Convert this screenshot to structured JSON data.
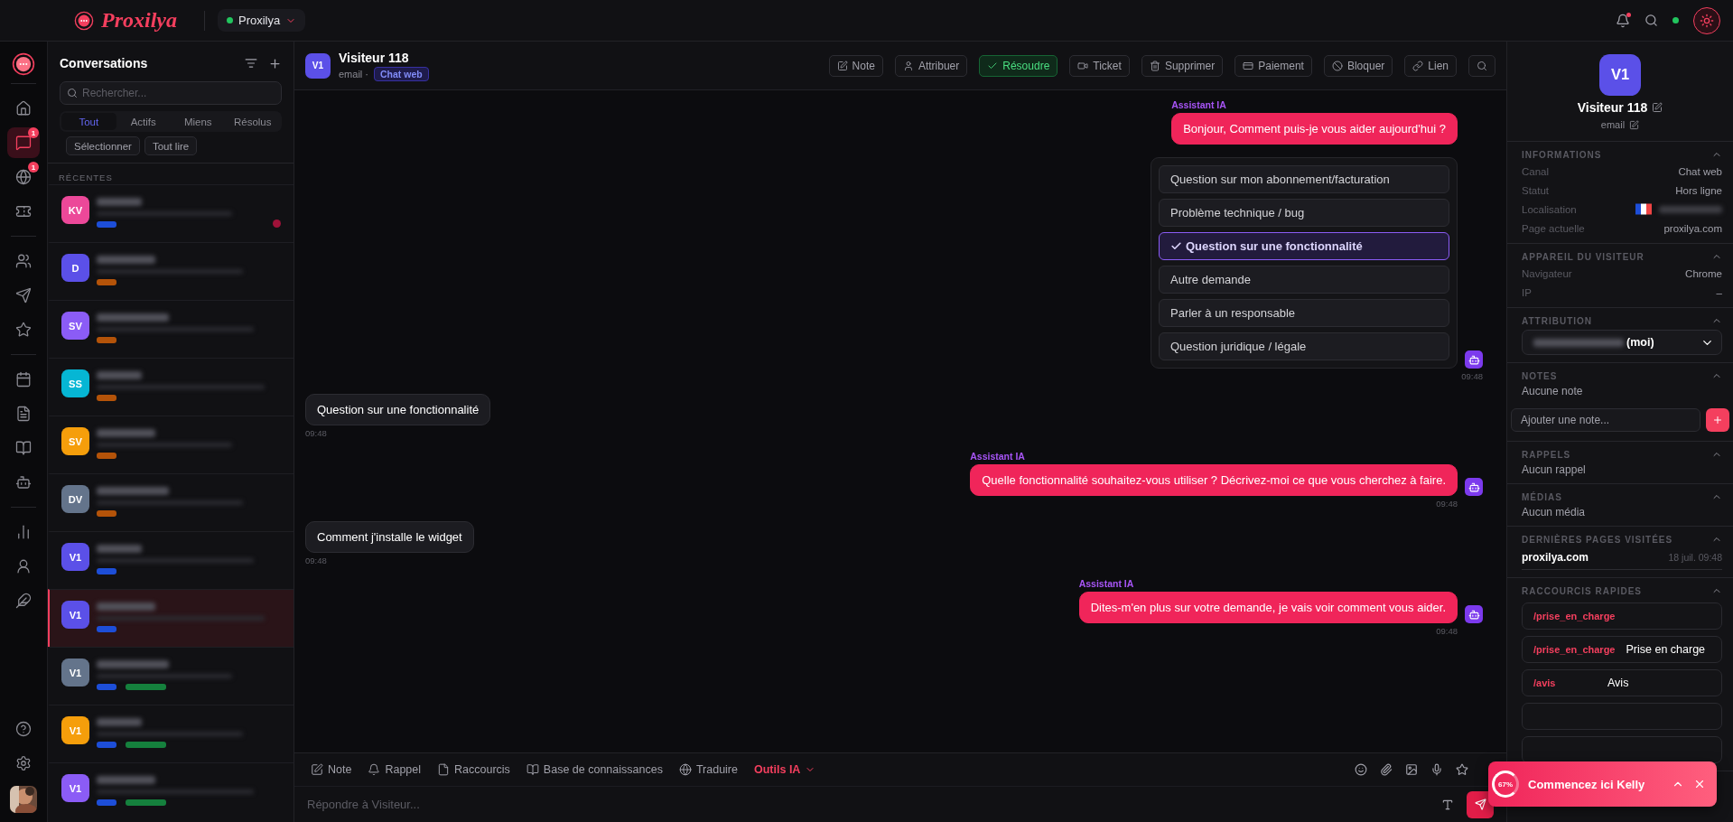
{
  "topbar": {
    "brand": "Proxilya",
    "workspace": "Proxilya",
    "workspace_online": true,
    "notification": true,
    "online": true
  },
  "rail": {
    "groups": [
      [
        {
          "selected": false
        },
        {
          "selected": true,
          "badge": "1"
        },
        {
          "selected": false,
          "badge": "1"
        },
        {
          "selected": false
        }
      ],
      [
        {
          "selected": false
        },
        {
          "selected": false
        },
        {
          "selected": false
        }
      ],
      [
        {
          "selected": false
        },
        {
          "selected": false
        },
        {
          "selected": false
        },
        {
          "selected": false
        }
      ],
      [
        {
          "selected": false
        },
        {
          "selected": false
        },
        {
          "selected": false
        }
      ]
    ],
    "bottom": [
      {
        "selected": false
      },
      {
        "selected": false
      }
    ]
  },
  "conversations": {
    "title": "Conversations",
    "search_placeholder": "Rechercher...",
    "tabs": [
      {
        "label": "Tout",
        "selected": true
      },
      {
        "label": "Actifs",
        "selected": false
      },
      {
        "label": "Miens",
        "selected": false
      },
      {
        "label": "Résolus",
        "selected": false
      }
    ],
    "actions": [
      "Sélectionner",
      "Tout lire"
    ],
    "section": "RÉCENTES",
    "items": [
      {
        "initials": "KV",
        "color": "#ec4899",
        "selected": false,
        "unread": true,
        "tags": [
          {
            "color": "#1d4ed8"
          }
        ]
      },
      {
        "initials": "D",
        "color": "#5b50e8",
        "selected": false,
        "unread": false,
        "tags": [
          {
            "color": "#b45309"
          }
        ]
      },
      {
        "initials": "SV",
        "color": "#8b5cf6",
        "selected": false,
        "unread": false,
        "tags": [
          {
            "color": "#b45309"
          }
        ]
      },
      {
        "initials": "SS",
        "color": "#06b6d4",
        "selected": false,
        "unread": false,
        "tags": [
          {
            "color": "#b45309"
          }
        ]
      },
      {
        "initials": "SV",
        "color": "#f59e0b",
        "selected": false,
        "unread": false,
        "tags": [
          {
            "color": "#b45309"
          }
        ]
      },
      {
        "initials": "DV",
        "color": "#64748b",
        "selected": false,
        "unread": false,
        "tags": [
          {
            "color": "#b45309"
          }
        ]
      },
      {
        "initials": "V1",
        "color": "#5b50e8",
        "selected": false,
        "unread": false,
        "tags": [
          {
            "color": "#1d4ed8"
          }
        ]
      },
      {
        "initials": "V1",
        "color": "#5b50e8",
        "selected": true,
        "unread": false,
        "tags": [
          {
            "color": "#1d4ed8"
          }
        ]
      },
      {
        "initials": "V1",
        "color": "#64748b",
        "selected": false,
        "unread": false,
        "tags": [
          {
            "color": "#1d4ed8"
          },
          {
            "color": "#15803d"
          }
        ]
      },
      {
        "initials": "V1",
        "color": "#f59e0b",
        "selected": false,
        "unread": false,
        "tags": [
          {
            "color": "#1d4ed8"
          },
          {
            "color": "#15803d"
          }
        ]
      },
      {
        "initials": "V1",
        "color": "#8b5cf6",
        "selected": false,
        "unread": false,
        "tags": [
          {
            "color": "#1d4ed8"
          },
          {
            "color": "#15803d"
          }
        ]
      }
    ]
  },
  "chat": {
    "avatar": "V1",
    "title": "Visiteur 118",
    "subtitle": "email ·",
    "channel": "Chat web",
    "actions": [
      {
        "label": "Note",
        "kind": "plain"
      },
      {
        "label": "Attribuer",
        "kind": "plain"
      },
      {
        "label": "Résoudre",
        "kind": "success"
      },
      {
        "label": "Ticket",
        "kind": "plain"
      },
      {
        "label": "Supprimer",
        "kind": "plain"
      },
      {
        "label": "Paiement",
        "kind": "plain"
      },
      {
        "label": "Bloquer",
        "kind": "plain"
      },
      {
        "label": "Lien",
        "kind": "plain"
      },
      {
        "kind": "icon"
      }
    ],
    "messages": [
      {
        "kind": "bot",
        "sender": "Assistant IA",
        "text": "Bonjour, Comment puis-je vous aider aujourd'hui ?"
      },
      {
        "kind": "choices",
        "time": "09:48",
        "options": [
          {
            "label": "Question sur mon abonnement/facturation",
            "selected": false
          },
          {
            "label": "Problème technique / bug",
            "selected": false
          },
          {
            "label": "Question sur une fonctionnalité",
            "selected": true
          },
          {
            "label": "Autre demande",
            "selected": false
          },
          {
            "label": "Parler à un responsable",
            "selected": false
          },
          {
            "label": "Question juridique / légale",
            "selected": false
          }
        ]
      },
      {
        "kind": "user",
        "text": "Question sur une fonctionnalité",
        "time": "09:48"
      },
      {
        "kind": "bot",
        "sender": "Assistant IA",
        "text": "Quelle fonctionnalité souhaitez-vous utiliser ? Décrivez-moi ce que vous cherchez à faire.",
        "time": "09:48"
      },
      {
        "kind": "user",
        "text": "Comment j'installe le widget",
        "time": "09:48"
      },
      {
        "kind": "bot",
        "sender": "Assistant IA",
        "text": "Dites-m'en plus sur votre demande, je vais voir comment vous aider.",
        "time": "09:48"
      }
    ],
    "tools": [
      {
        "label": "Note",
        "kind": "plain"
      },
      {
        "label": "Rappel",
        "kind": "plain"
      },
      {
        "label": "Raccourcis",
        "kind": "plain"
      },
      {
        "label": "Base de connaissances",
        "kind": "plain"
      },
      {
        "label": "Traduire",
        "kind": "plain"
      },
      {
        "label": "Outils IA",
        "kind": "accent"
      }
    ],
    "reply_placeholder": "Répondre à Visiteur..."
  },
  "contact": {
    "avatar": "V1",
    "name": "Visiteur 118",
    "email": "email",
    "sections": [
      {
        "kind": "info",
        "title": "INFORMATIONS",
        "expanded": true,
        "rows": [
          {
            "label": "Canal",
            "value": "Chat web"
          },
          {
            "label": "Statut",
            "value": "Hors ligne"
          },
          {
            "label": "Localisation",
            "flag": true
          },
          {
            "label": "Page actuelle",
            "value": "proxilya.com"
          }
        ]
      },
      {
        "kind": "info",
        "title": "APPAREIL DU VISITEUR",
        "expanded": true,
        "rows": [
          {
            "label": "Navigateur",
            "value": "Chrome"
          },
          {
            "label": "IP",
            "value": "–"
          }
        ]
      },
      {
        "kind": "select",
        "title": "ATTRIBUTION",
        "expanded": true,
        "value": "(moi)"
      },
      {
        "kind": "notes",
        "title": "NOTES",
        "expanded": true,
        "empty": "Aucune note",
        "placeholder": "Ajouter une note..."
      },
      {
        "kind": "text",
        "title": "RAPPELS",
        "expanded": true,
        "empty": "Aucun rappel"
      },
      {
        "kind": "text",
        "title": "MÉDIAS",
        "expanded": true,
        "empty": "Aucun média"
      },
      {
        "kind": "pages",
        "title": "DERNIÈRES PAGES VISITÉES",
        "expanded": true,
        "pages": [
          {
            "url": "proxilya.com",
            "time": "18 juil. 09:48"
          }
        ]
      },
      {
        "kind": "shortcuts",
        "title": "RACCOURCIS RAPIDES",
        "expanded": true,
        "shortcuts": [
          {
            "command": "/prise_en_charge"
          },
          {
            "command": "/prise_en_charge",
            "label": "Prise en charge"
          },
          {
            "command": "/avis",
            "label": "Avis"
          }
        ]
      }
    ]
  },
  "toast": {
    "title": "Commencez ici Kelly",
    "progress": "67%"
  }
}
